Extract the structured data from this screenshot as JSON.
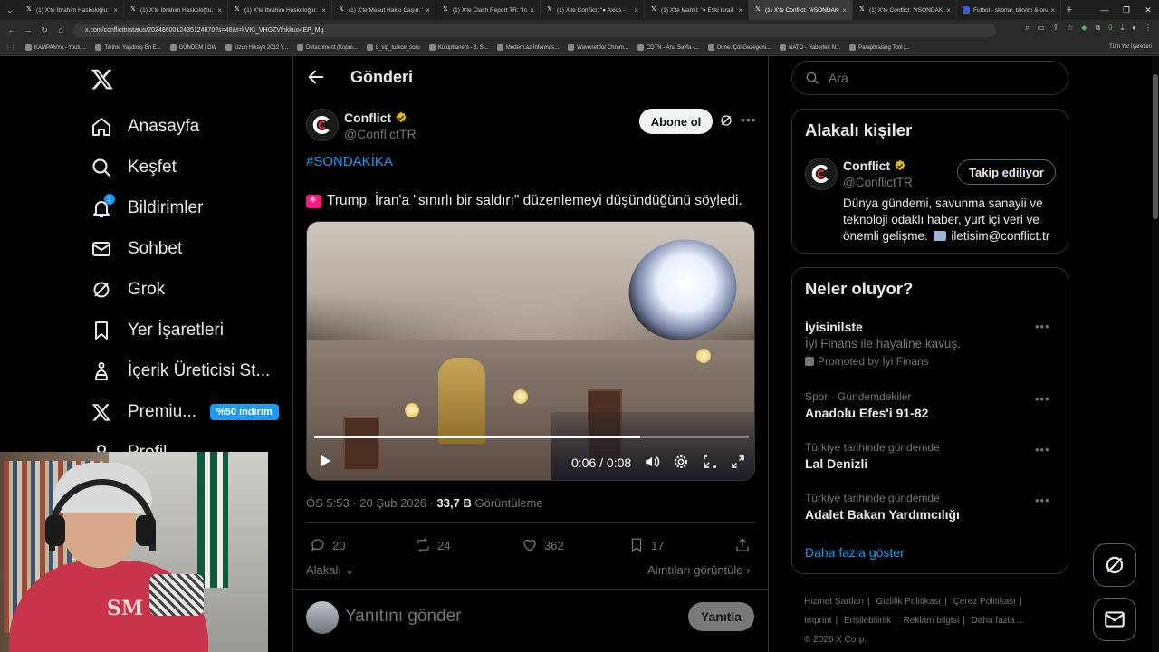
{
  "browser": {
    "tabs": [
      {
        "title": "(1) X'te İbrahim Haskoloğlu: \"(",
        "active": false
      },
      {
        "title": "(1) X'te İbrahim Haskoloğlu: \"",
        "active": false
      },
      {
        "title": "(1) X'te İbrahim Haskoloğlu: \"",
        "active": false
      },
      {
        "title": "(1) X'te Mesut Hakkı Caşın: \"İs",
        "active": false
      },
      {
        "title": "(1) X'te Clash Report TR: \"İran",
        "active": false
      },
      {
        "title": "(1) X'te Conflict: \"● Axios -",
        "active": false
      },
      {
        "title": "(1) X'te Mahfil: \"● Eski İsrail",
        "active": false
      },
      {
        "title": "(1) X'te Conflict: \"#SONDAKİ",
        "active": true
      },
      {
        "title": "(1) X'te Conflict: \"#SONDAKİ",
        "active": false
      },
      {
        "title": "Futbol - skorlar, takvim & ona",
        "active": false
      }
    ],
    "url": "x.com/conflicttr/status/2024860012435124670?s=48&t=kVKI_VHGZVfhkkuo4EP_Mg",
    "bookmarks": [
      "KAMPANYA - Youtu...",
      "Tarihte Yaşdmış En E...",
      "GÜNDEM | DW",
      "Uzun Hikaye 2012 Y...",
      "Detachment (Kopm...",
      "8_vip_turkce_soru",
      "Kütüphanem - 8. S...",
      "Modern.az İnformas...",
      "Wavenet for Chrom...",
      "CDTN - Ana Sayfa -...",
      "Dune: Çöl Gezegeni...",
      "NATO - Haberler: N...",
      "Paraphrasing Tool |..."
    ],
    "bookmarks_right": "Tüm Yer İşaretleri",
    "ext_badge": "0"
  },
  "nav": {
    "items": [
      {
        "label": "Anasayfa",
        "icon": "home-icon"
      },
      {
        "label": "Keşfet",
        "icon": "search-icon"
      },
      {
        "label": "Bildirimler",
        "icon": "bell-icon",
        "badge": "1"
      },
      {
        "label": "Sohbet",
        "icon": "mail-icon"
      },
      {
        "label": "Grok",
        "icon": "grok-icon"
      },
      {
        "label": "Yer İşaretleri",
        "icon": "bookmark-icon"
      },
      {
        "label": "İçerik Üreticisi St...",
        "icon": "creator-studio-icon"
      },
      {
        "label": "Premiu...",
        "icon": "x-logo-icon",
        "promo": "%50 indirim"
      },
      {
        "label": "Profil",
        "icon": "profile-icon"
      }
    ]
  },
  "post": {
    "header_title": "Gönderi",
    "author_name": "Conflict",
    "author_handle": "@ConflictTR",
    "follow_label": "Abone ol",
    "hashtag": "#SONDAKİKA",
    "text": "Trump, İran'a \"sınırlı bir saldırı\" düzenlemeyi düşündüğünü söyledi.",
    "video_time": "0:06 / 0:08",
    "video_progress": 0.75,
    "time": "ÖS 5:53 · 20 Şub 2026 · ",
    "views_count": "33,7 B",
    "views_label": " Görüntüleme",
    "replies": "20",
    "reposts": "24",
    "likes": "362",
    "bookmarks": "17",
    "sort_label": "Alakalı",
    "quotes_label": "Alıntıları görüntüle",
    "reply_placeholder": "Yanıtını gönder",
    "reply_button": "Yanıtla"
  },
  "sidebar": {
    "search_placeholder": "Ara",
    "related_title": "Alakalı kişiler",
    "related": {
      "name": "Conflict",
      "handle": "@ConflictTR",
      "button": "Takip ediliyor",
      "bio_a": "Dünya gündemi, savunma sanayii ve teknoloji odaklı haber, yurt içi veri ve önemli gelişme.",
      "bio_b": " iletisim@conflict.tr"
    },
    "trends_title": "Neler oluyor?",
    "trends": [
      {
        "context": "",
        "title": "İyisinilste",
        "subtitle": "İyi Finans ile hayaline kavuş.",
        "promoted": "Promoted by İyi Finans"
      },
      {
        "context": "Spor · Gündemdekiler",
        "title": "Anadolu Efes'i 91-82"
      },
      {
        "context": "Türkiye tarihinde gündemde",
        "title": "Lal Denizli"
      },
      {
        "context": "Türkiye tarihinde gündemde",
        "title": "Adalet Bakan Yardımcılığı"
      }
    ],
    "show_more": "Daha fazla göster",
    "footer": [
      "Hizmet Şartları",
      "Gizlilik Politikası",
      "Çerez Politikası",
      "Imprint",
      "Erişilebilirlik",
      "Reklam bilgisi",
      "Daha fazla ...",
      "© 2026 X Corp."
    ]
  },
  "colors": {
    "accent": "#1d9bf0",
    "background": "#000000",
    "text": "#e7e9ea",
    "muted": "#71767b",
    "verified_gold": "#e2b719",
    "promo_badge": "#1d9bf0"
  }
}
